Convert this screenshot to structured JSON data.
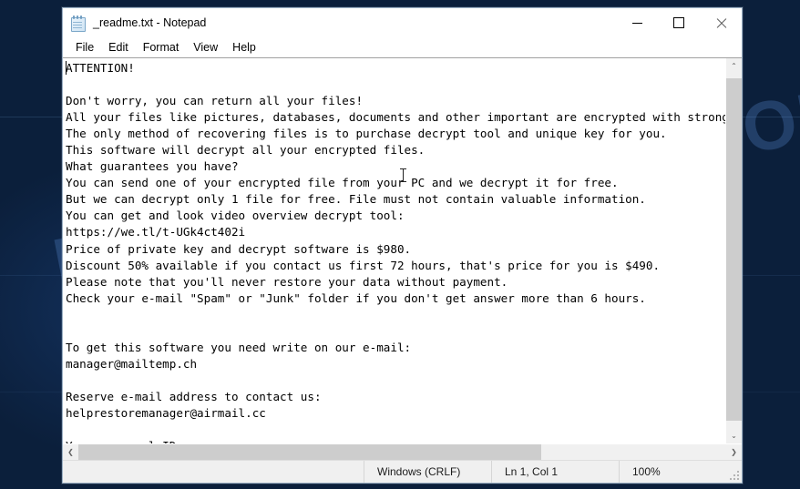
{
  "window": {
    "title": "_readme.txt - Notepad",
    "icon": "notepad-icon",
    "controls": {
      "minimize": "—",
      "maximize": "□",
      "close": "×"
    }
  },
  "menubar": {
    "items": [
      {
        "label": "File"
      },
      {
        "label": "Edit"
      },
      {
        "label": "Format"
      },
      {
        "label": "View"
      },
      {
        "label": "Help"
      }
    ]
  },
  "document": {
    "filename": "_readme.txt",
    "body": "ATTENTION!\n\nDon't worry, you can return all your files!\nAll your files like pictures, databases, documents and other important are encrypted with strongest encryption and unique key.\nThe only method of recovering files is to purchase decrypt tool and unique key for you.\nThis software will decrypt all your encrypted files.\nWhat guarantees you have?\nYou can send one of your encrypted file from your PC and we decrypt it for free.\nBut we can decrypt only 1 file for free. File must not contain valuable information.\nYou can get and look video overview decrypt tool:\nhttps://we.tl/t-UGk4ct402i\nPrice of private key and decrypt software is $980.\nDiscount 50% available if you contact us first 72 hours, that's price for you is $490.\nPlease note that you'll never restore your data without payment.\nCheck your e-mail \"Spam\" or \"Junk\" folder if you don't get answer more than 6 hours.\n\n\nTo get this software you need write on our e-mail:\nmanager@mailtemp.ch\n\nReserve e-mail address to contact us:\nhelprestoremanager@airmail.cc\n\nYour personal ID:",
    "lines": [
      "ATTENTION!",
      "",
      "Don't worry, you can return all your files!",
      "All your files like pictures, databases, documents and other important are encrypted with strongest encryption and unique key.",
      "The only method of recovering files is to purchase decrypt tool and unique key for you.",
      "This software will decrypt all your encrypted files.",
      "What guarantees you have?",
      "You can send one of your encrypted file from your PC and we decrypt it for free.",
      "But we can decrypt only 1 file for free. File must not contain valuable information.",
      "You can get and look video overview decrypt tool:",
      "https://we.tl/t-UGk4ct402i",
      "Price of private key and decrypt software is $980.",
      "Discount 50% available if you contact us first 72 hours, that's price for you is $490.",
      "Please note that you'll never restore your data without payment.",
      "Check your e-mail \"Spam\" or \"Junk\" folder if you don't get answer more than 6 hours.",
      "",
      "",
      "To get this software you need write on our e-mail:",
      "manager@mailtemp.ch",
      "",
      "Reserve e-mail address to contact us:",
      "helprestoremanager@airmail.cc",
      "",
      "Your personal ID:"
    ],
    "ransom_details": {
      "video_url": "https://we.tl/t-UGk4ct402i",
      "price_full": "$980",
      "price_discount": "$490",
      "discount_percent": "50%",
      "discount_window": "72 hours",
      "primary_email": "manager@mailtemp.ch",
      "reserve_email": "helprestoremanager@airmail.cc",
      "response_time": "6 hours"
    }
  },
  "statusbar": {
    "line_ending": "Windows (CRLF)",
    "cursor_position": "Ln 1, Col 1",
    "zoom": "100%"
  },
  "scrollbars": {
    "vertical_up": "⌃",
    "vertical_down": "⌄",
    "horizontal_left": "❮",
    "horizontal_right": "❯"
  },
  "desktop": {
    "watermark": "MYANTISPYWARE.COM",
    "background_color": "#0b1f3b"
  },
  "colors": {
    "window_background": "#ffffff",
    "scrollbar_track": "#f0f0f0",
    "scrollbar_thumb": "#cdcdcd",
    "statusbar_background": "#f0f0f0",
    "text_color": "#000000",
    "desktop_blue": "#0b1f3b",
    "watermark_blue": "#5a8cd2"
  }
}
